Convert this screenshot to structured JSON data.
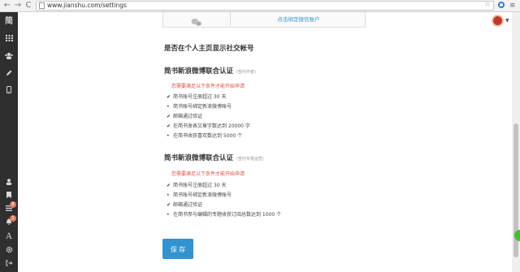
{
  "browser": {
    "url": "www.jianshu.com/settings",
    "back_glyph": "←",
    "forward_glyph": "→",
    "reload_glyph": "C",
    "star_glyph": "☆",
    "menu_glyph": "≡"
  },
  "sidebar": {
    "logo": "简",
    "badges": [
      "8",
      "1"
    ],
    "font_glyph": "A"
  },
  "binding": {
    "link_text": "点击绑定微信账户"
  },
  "social_section_title": "是否在个人主页显示社交帐号",
  "auth_sections": [
    {
      "title": "简书新浪微博联合认证",
      "subtitle": "(签约作者)",
      "note": "您需要满足以下条件才能开始申请",
      "requirements": [
        {
          "text": "简书账号注册超过 30 天",
          "met": true
        },
        {
          "text": "简书账号绑定新浪微博账号",
          "met": false
        },
        {
          "text": "邮箱通过验证",
          "met": true
        },
        {
          "text": "在简书发表文章字数达到 20000 字",
          "met": true
        },
        {
          "text": "在简书收获喜欢数达到 5000 个",
          "met": false
        }
      ]
    },
    {
      "title": "简书新浪微博联合认证",
      "subtitle": "(签约专题运营)",
      "note": "您需要满足以下条件才能开始申请",
      "requirements": [
        {
          "text": "简书账号注册超过 30 天",
          "met": true
        },
        {
          "text": "简书账号绑定新浪微博账号",
          "met": false
        },
        {
          "text": "邮箱通过验证",
          "met": true
        },
        {
          "text": "在简书参与编辑的专题收获订阅总数达到 1000 个",
          "met": false
        }
      ]
    }
  ],
  "save_label": "保 存",
  "colors": {
    "accent": "#3194d0",
    "warning": "#e05244",
    "sidebar": "#2f2f2f"
  }
}
